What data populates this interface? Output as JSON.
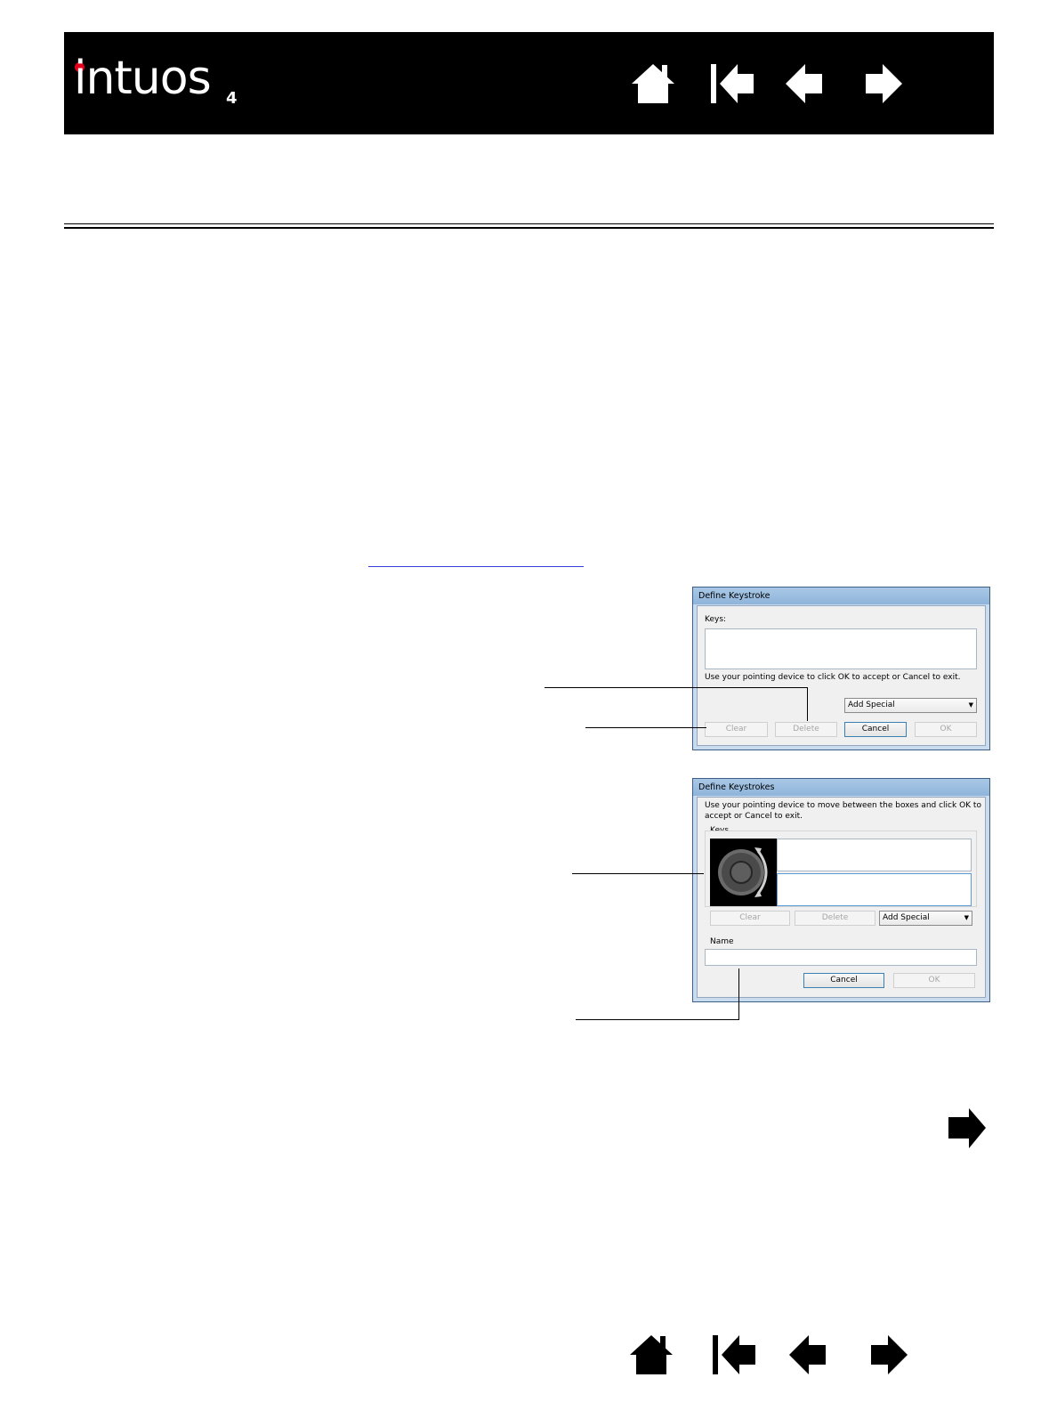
{
  "header": {
    "logo_text": "intuos",
    "logo_sup": "4",
    "nav": {
      "home_icon": "home-icon",
      "first_icon": "first-page-icon",
      "prev_icon": "previous-page-icon",
      "next_icon": "next-page-icon"
    }
  },
  "dialog1": {
    "title": "Define Keystroke",
    "keys_label": "Keys:",
    "instruction": "Use your pointing device to click OK to accept or Cancel to exit.",
    "add_special": "Add Special",
    "clear": "Clear",
    "delete": "Delete",
    "cancel": "Cancel",
    "ok": "OK"
  },
  "dialog2": {
    "title": "Define Keystrokes",
    "instruction_line1": "Use your pointing device to move between the boxes and click OK to",
    "instruction_line2": "accept or Cancel to exit.",
    "keys_label": "Keys",
    "clear": "Clear",
    "delete": "Delete",
    "add_special": "Add Special",
    "name_label": "Name",
    "cancel": "Cancel",
    "ok": "OK"
  },
  "colors": {
    "banner": "#000000",
    "logo_dot": "#e3001b",
    "link": "#3a3ad6"
  }
}
